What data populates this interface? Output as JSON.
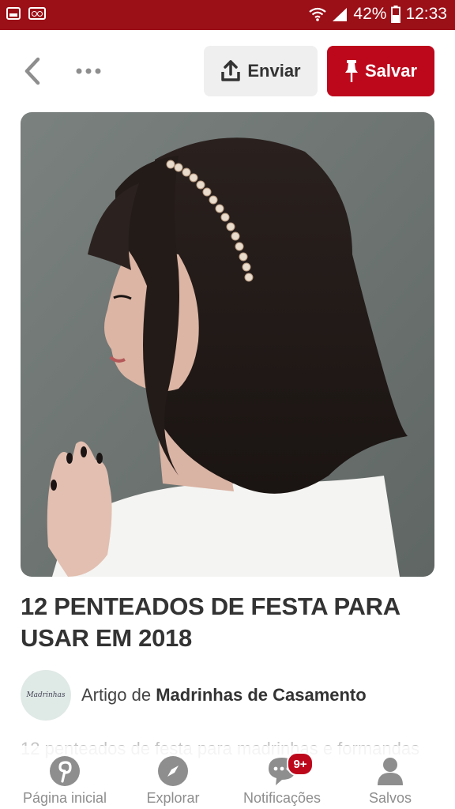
{
  "status_bar": {
    "battery": "42%",
    "time": "12:33",
    "icons": [
      "gallery-icon",
      "voicemail-icon",
      "wifi-icon",
      "signal-icon"
    ]
  },
  "toolbar": {
    "back_icon": "chevron-left-icon",
    "more_icon": "more-horizontal-icon",
    "send_label": "Enviar",
    "save_label": "Salvar",
    "save_color": "#bd081c"
  },
  "pin": {
    "title": "12 PENTEADOS DE FESTA PARA USAR EM 2018",
    "author_prefix": "Artigo de",
    "author_name": "Madrinhas de Casamento",
    "avatar_text": "Madrinhas",
    "description": "12 penteados de festa para madrinhas e formandas"
  },
  "bottom_nav": {
    "items": [
      {
        "label": "Página inicial",
        "icon": "pinterest-icon"
      },
      {
        "label": "Explorar",
        "icon": "compass-icon"
      },
      {
        "label": "Notificações",
        "icon": "chat-bubble-icon",
        "badge": "9+"
      },
      {
        "label": "Salvos",
        "icon": "person-icon"
      }
    ]
  }
}
